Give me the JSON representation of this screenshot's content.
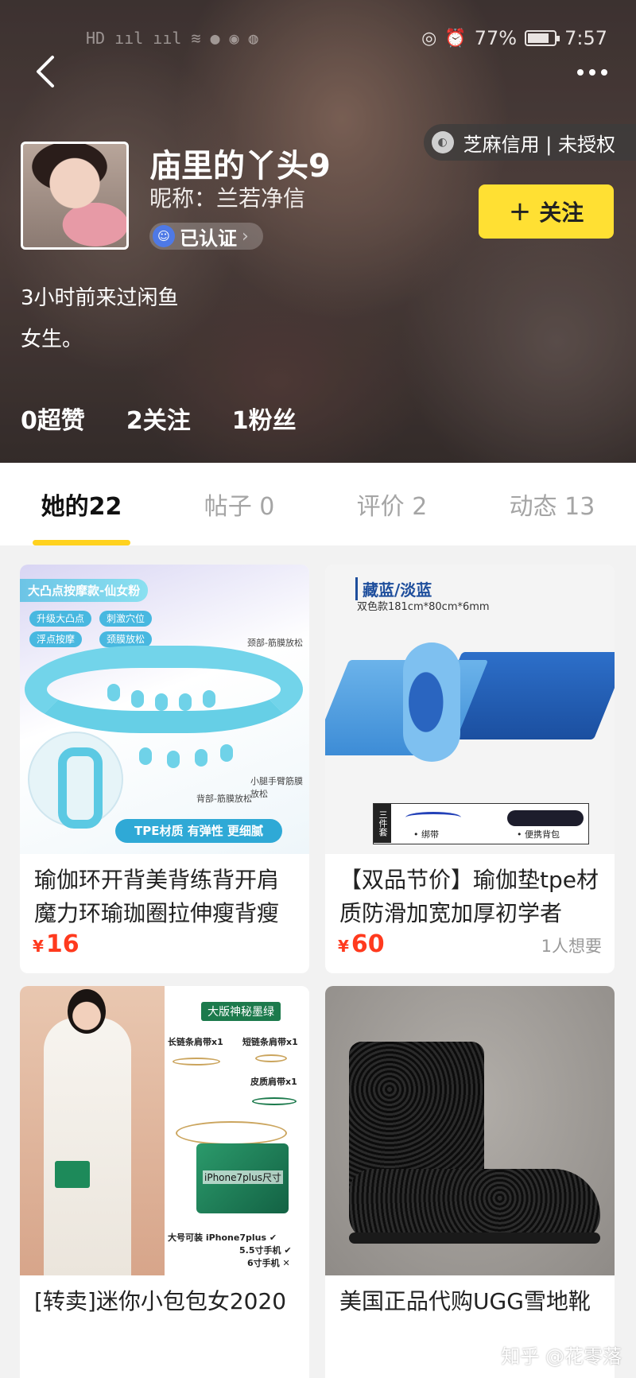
{
  "status_bar": {
    "signal_text": "HD ııl ııl",
    "battery": "77%",
    "time": "7:57"
  },
  "credit": {
    "text": "芝麻信用 | 未授权"
  },
  "profile": {
    "username": "庙里的丫头9",
    "nickname": "昵称：兰若净信",
    "verified": "已认证",
    "follow_label": "关注",
    "last_seen": "3小时前来过闲鱼",
    "bio": "女生。",
    "stats": [
      "0超赞",
      "2关注",
      "1粉丝"
    ]
  },
  "tabs": [
    {
      "label": "她的22",
      "active": true
    },
    {
      "label": "帖子 0",
      "active": false
    },
    {
      "label": "评价 2",
      "active": false
    },
    {
      "label": "动态 13",
      "active": false
    }
  ],
  "products": [
    {
      "title": "瑜伽环开背美背练背开肩魔力环瑜珈圈拉伸瘦背瘦",
      "currency": "¥",
      "price": "16",
      "wants": "",
      "image_text": {
        "banner": "大凸点按摩款-仙女粉",
        "tags": [
          "升级大凸点",
          "刺激穴位",
          "浮点按摩",
          "颈膜放松"
        ],
        "note1": "颈部-筋膜放松",
        "note2": "小腿手臂筋膜放松",
        "note3": "背部-筋膜放松",
        "bottom": "TPE材质 有弹性 更细腻"
      }
    },
    {
      "title": "【双品节价】瑜伽垫tpe材质防滑加宽加厚初学者",
      "currency": "¥",
      "price": "60",
      "wants": "1人想要",
      "image_text": {
        "title": "藏蓝/淡蓝",
        "sub": "双色款181cm*80cm*6mm",
        "set_label": "三件套",
        "item1": "• 绑带",
        "item2": "• 便携背包"
      }
    },
    {
      "title": "[转卖]迷你小包包女2020",
      "currency": "",
      "price": "",
      "wants": "",
      "image_text": {
        "label": "大版神秘墨绿",
        "t1": "长链条肩带x1",
        "t2": "短链条肩带x1",
        "t3": "皮质肩带x1",
        "bag": "iPhone7plus尺寸",
        "s1": "大号可装 iPhone7plus ✔",
        "s2": "5.5寸手机 ✔",
        "s3": "6寸手机 ✕"
      }
    },
    {
      "title": "美国正品代购UGG雪地靴",
      "currency": "",
      "price": "",
      "wants": ""
    }
  ],
  "watermark": "知乎 @花零落",
  "colors": {
    "accent": "#ffe033",
    "tab_indicator": "#ffd21f",
    "price": "#ff3a1e"
  }
}
